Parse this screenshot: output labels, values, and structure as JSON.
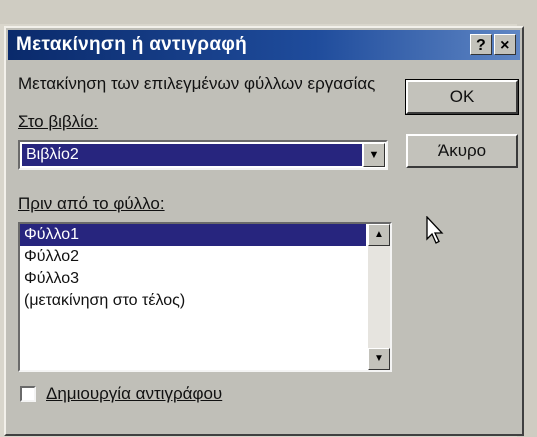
{
  "dialog": {
    "title": "Μετακίνηση ή αντιγραφή",
    "help_button": "?",
    "close_button": "×",
    "move_label": "Μετακίνηση των επιλεγμένων φύλλων εργασίας",
    "to_book_label": "Στο βιβλίο:",
    "to_book_value": "Βιβλίο2",
    "before_sheet_label": "Πριν από το φύλλο:",
    "sheets": [
      "Φύλλο1",
      "Φύλλο2",
      "Φύλλο3",
      "(μετακίνηση στο τέλος)"
    ],
    "selected_sheet_index": 0,
    "ok_label": "OK",
    "cancel_label": "Άκυρο",
    "create_copy_label": "Δημιουργία αντιγράφου",
    "create_copy_checked": false
  }
}
